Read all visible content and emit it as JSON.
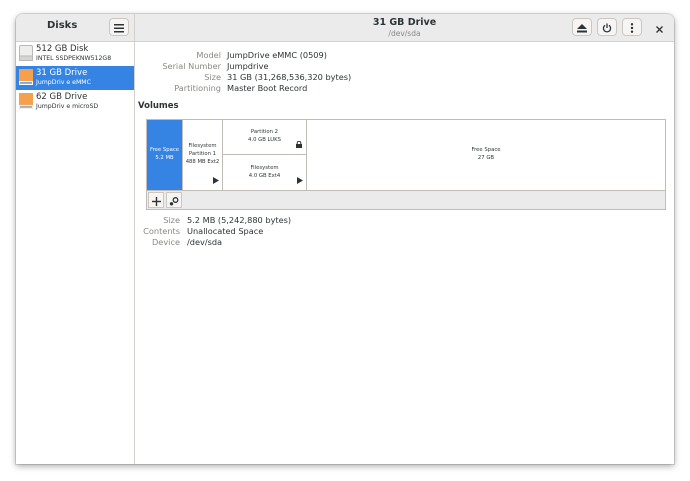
{
  "app": {
    "title": "Disks"
  },
  "header": {
    "drive_title": "31 GB Drive",
    "drive_path": "/dev/sda"
  },
  "drives": [
    {
      "name": "512 GB Disk",
      "model": "INTEL SSDPEKNW512G8",
      "icon": "hard-disk-icon",
      "selected": false
    },
    {
      "name": "31 GB Drive",
      "model": "JumpDriv e eMMC",
      "icon": "usb-drive-icon",
      "selected": true
    },
    {
      "name": "62 GB Drive",
      "model": "JumpDriv e microSD",
      "icon": "usb-drive-icon",
      "selected": false
    }
  ],
  "drive_info": {
    "model_label": "Model",
    "model": "JumpDrive eMMC (0509)",
    "serial_label": "Serial Number",
    "serial": "Jumpdrive",
    "size_label": "Size",
    "size": "31 GB (31,268,536,320 bytes)",
    "partitioning_label": "Partitioning",
    "partitioning": "Master Boot Record"
  },
  "volumes": {
    "title": "Volumes",
    "free1": {
      "line1": "Free Space",
      "line2": "5.2 MB"
    },
    "fs1": {
      "line1": "Filesystem",
      "line2": "Partition 1",
      "line3": "488 MB Ext2"
    },
    "part2": {
      "line1": "Partition 2",
      "line2": "4.0 GB LUKS"
    },
    "fs2": {
      "line1": "Filesystem",
      "line2": "4.0 GB Ext4"
    },
    "free2": {
      "line1": "Free Space",
      "line2": "27 GB"
    }
  },
  "selected_volume": {
    "size_label": "Size",
    "size": "5.2 MB (5,242,880 bytes)",
    "contents_label": "Contents",
    "contents": "Unallocated Space",
    "device_label": "Device",
    "device": "/dev/sda"
  },
  "colors": {
    "accent": "#3584e4",
    "drive_icon": "#f6a04d",
    "headerbar": "#ebebeb"
  }
}
